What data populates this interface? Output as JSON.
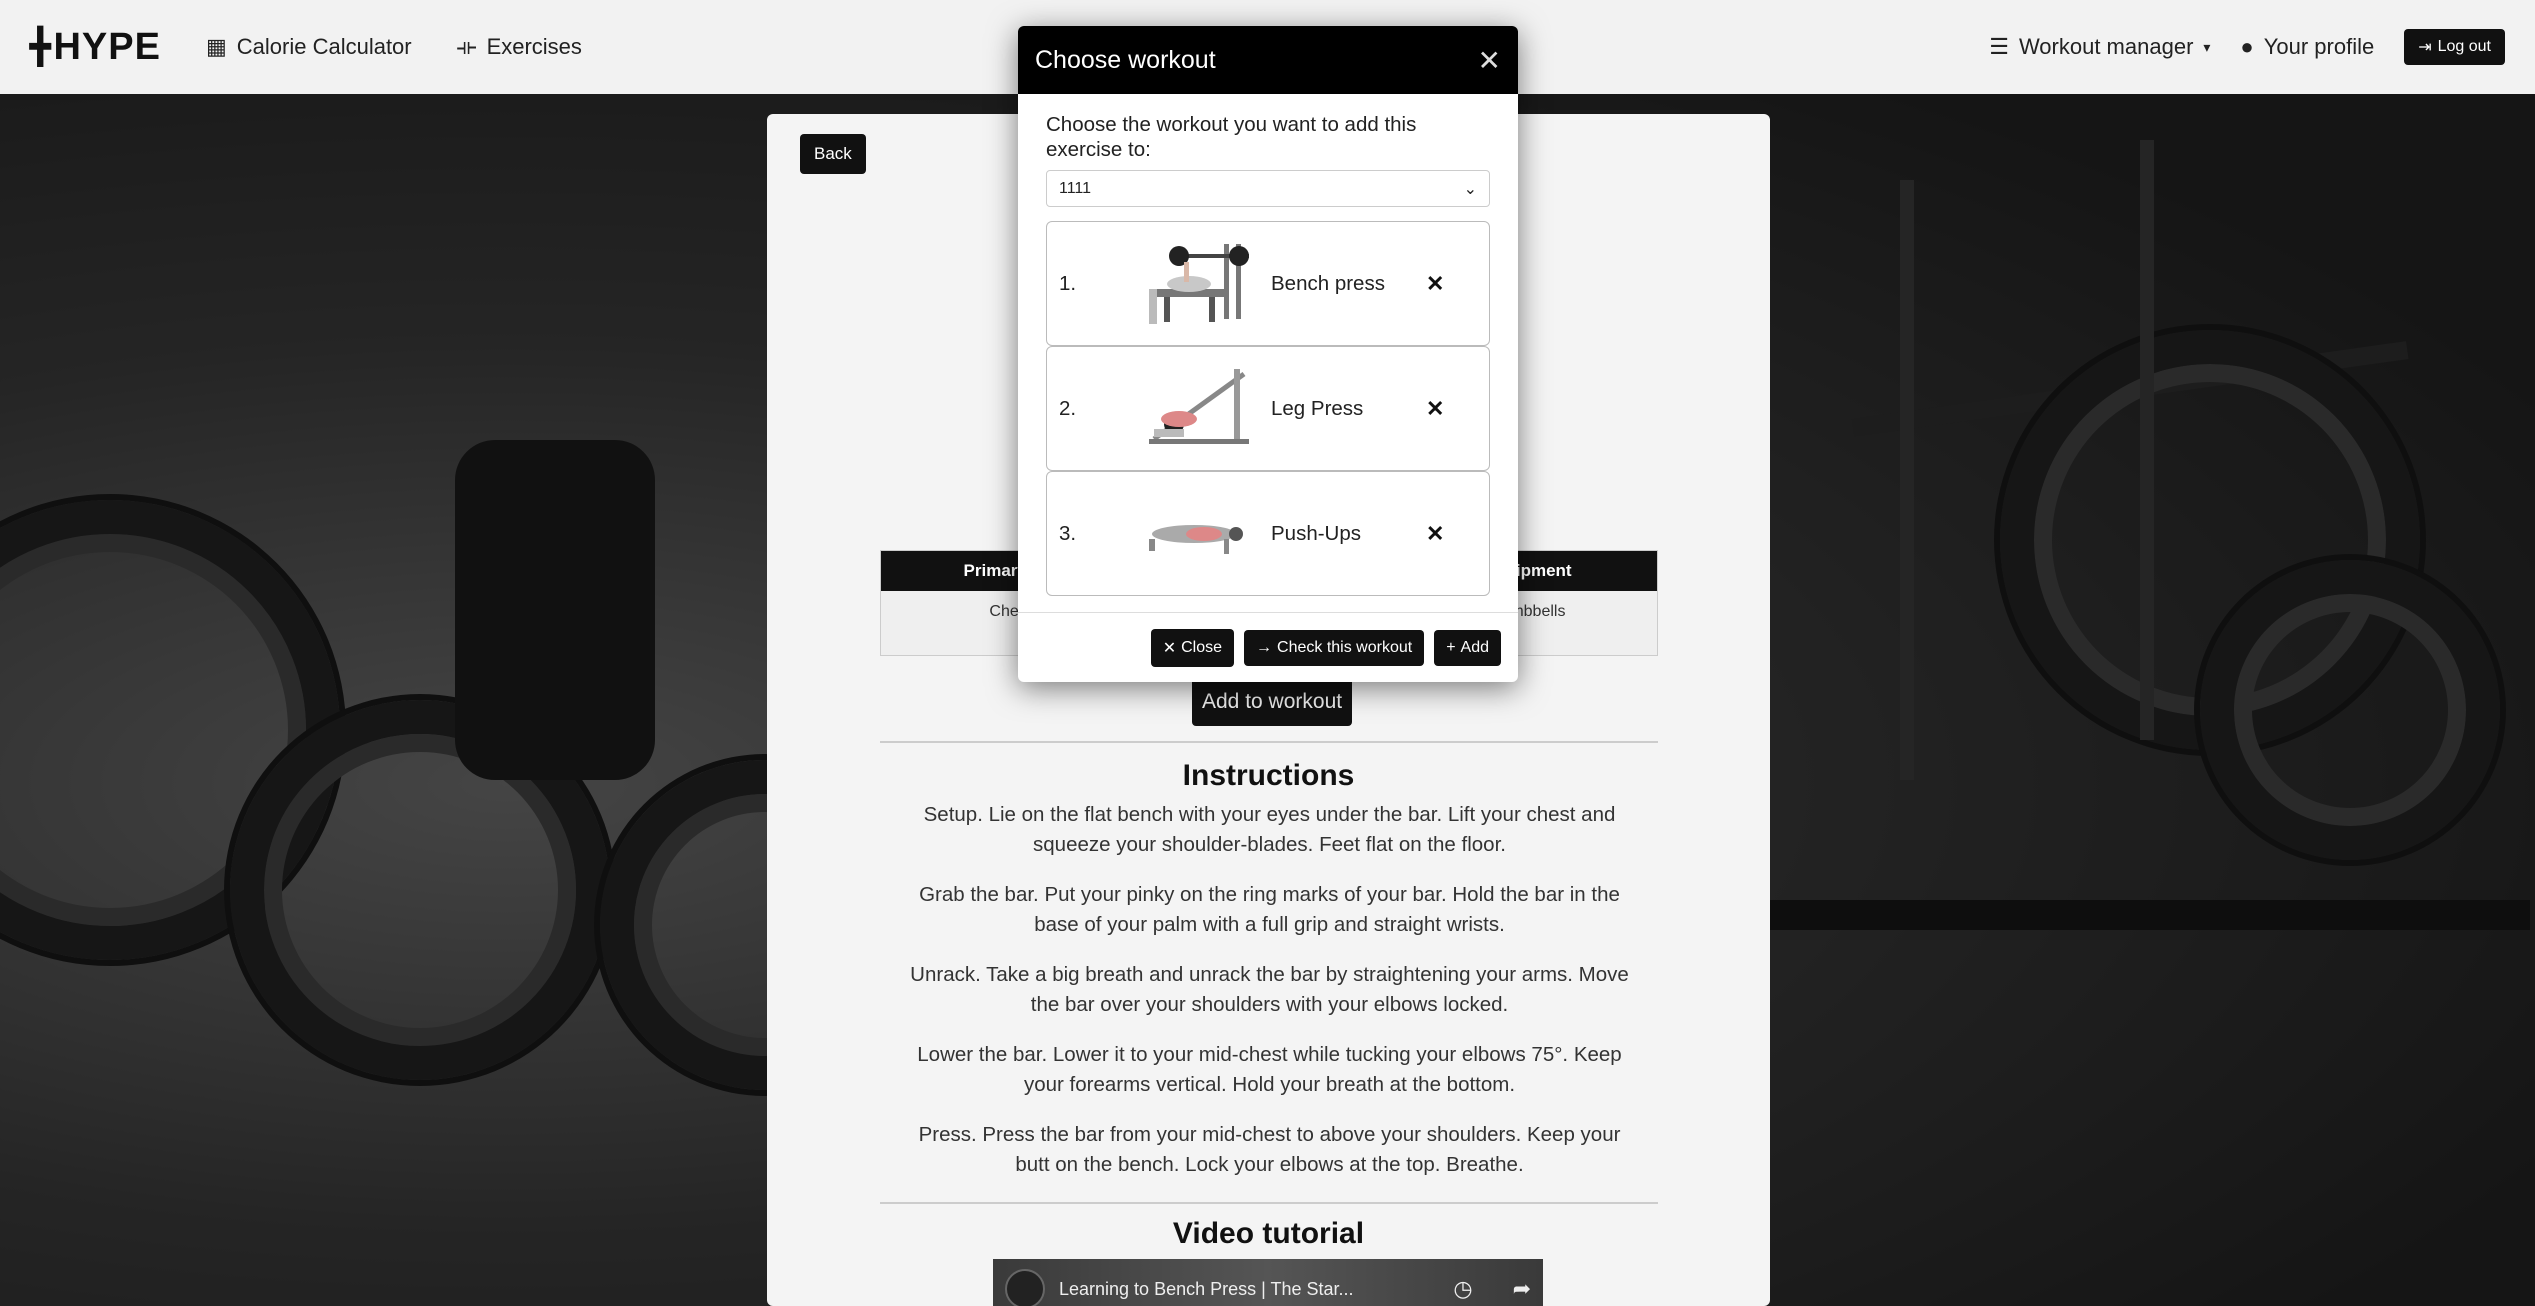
{
  "navbar": {
    "logo": "HYPE",
    "calorie_label": "Calorie Calculator",
    "exercises_label": "Exercises",
    "workout_manager_label": "Workout manager",
    "profile_label": "Your profile",
    "logout_label": "Log out"
  },
  "page": {
    "back_label": "Back",
    "table": {
      "headers": [
        "Primary mu",
        "",
        "Equipment"
      ],
      "row": [
        "Chest",
        "",
        "Dumbbells"
      ]
    },
    "add_to_workout_label": "Add to workout",
    "instructions_title": "Instructions",
    "instructions": [
      "Setup. Lie on the flat bench with your eyes under the bar. Lift your chest and squeeze your shoulder-blades. Feet flat on the floor.",
      "Grab the bar. Put your pinky on the ring marks of your bar. Hold the bar in the base of your palm with a full grip and straight wrists.",
      "Unrack. Take a big breath and unrack the bar by straightening your arms. Move the bar over your shoulders with your elbows locked.",
      "Lower the bar. Lower it to your mid-chest while tucking your elbows 75°. Keep your forearms vertical. Hold your breath at the bottom.",
      "Press. Press the bar from your mid-chest to above your shoulders. Keep your butt on the bench. Lock your elbows at the top. Breathe."
    ],
    "video_title": "Video tutorial",
    "video_caption": "Learning to Bench Press | The Star..."
  },
  "modal": {
    "title": "Choose workout",
    "prompt": "Choose the workout you want to add this exercise to:",
    "selected_workout": "1111",
    "exercises": [
      {
        "num": "1.",
        "name": "Bench press"
      },
      {
        "num": "2.",
        "name": "Leg Press"
      },
      {
        "num": "3.",
        "name": "Push-Ups"
      }
    ],
    "close_label": "Close",
    "check_label": "Check this workout",
    "add_label": "Add"
  }
}
